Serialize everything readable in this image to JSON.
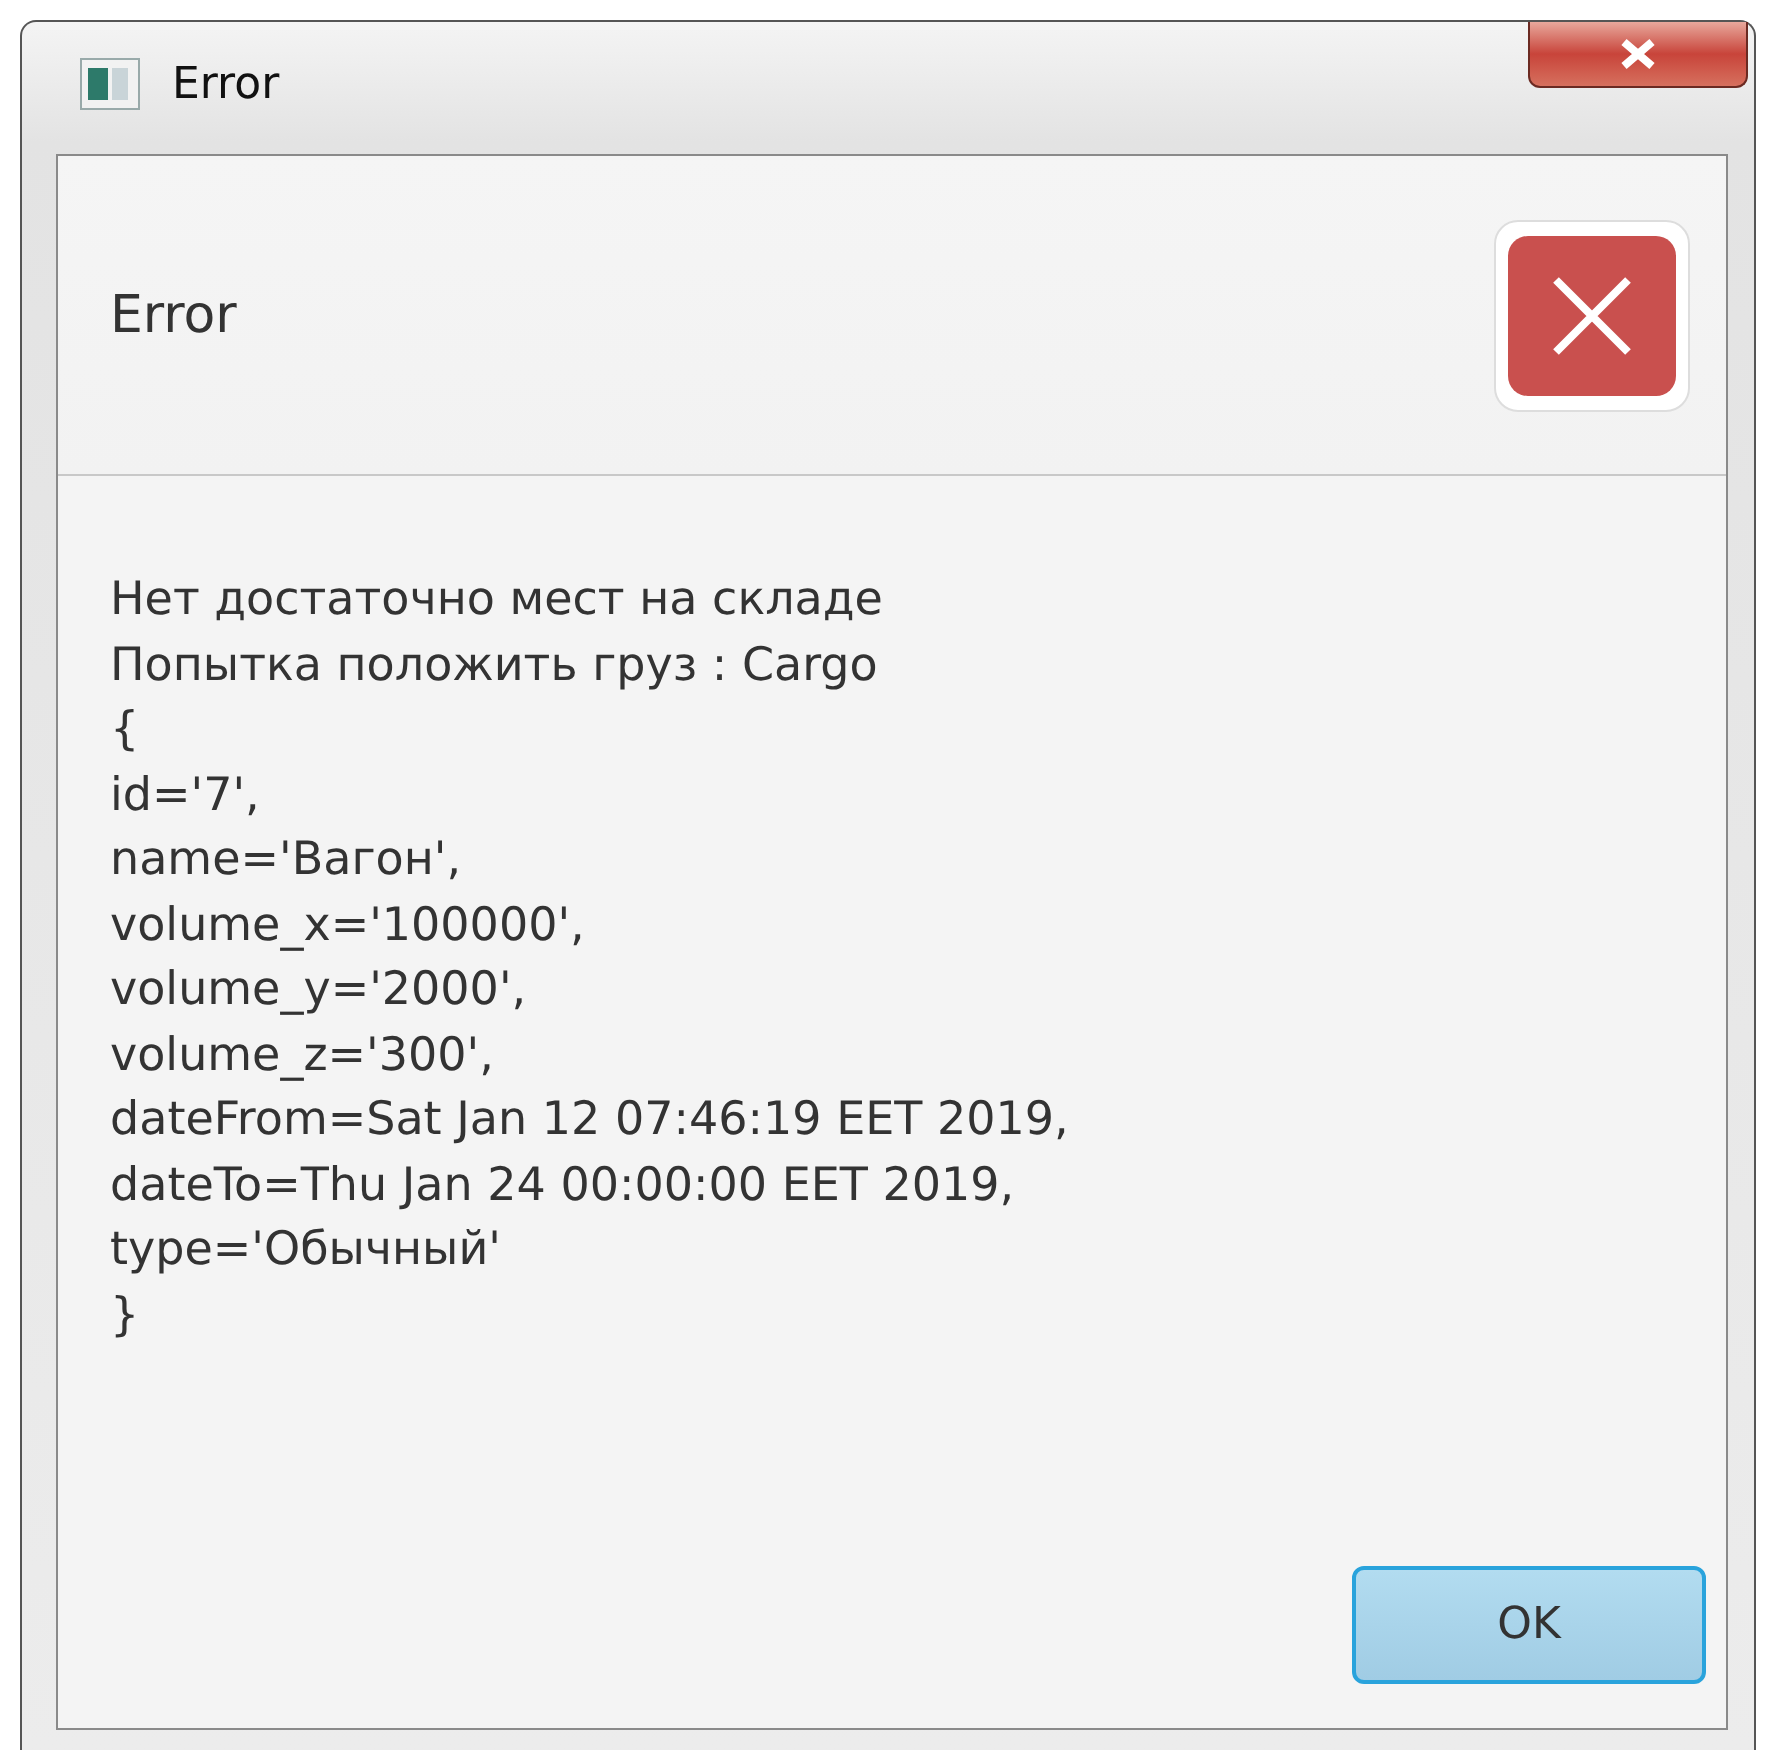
{
  "window": {
    "title": "Error"
  },
  "header": {
    "title": "Error"
  },
  "message_lines": [
    "Нет достаточно мест на складе",
    "Попытка положить груз : Cargo",
    "{",
    "id='7',",
    "name='Вагон',",
    "volume_x='100000',",
    "volume_y='2000',",
    "volume_z='300',",
    "dateFrom=Sat Jan 12 07:46:19 EET 2019,",
    "dateTo=Thu Jan 24 00:00:00 EET 2019,",
    "type='Обычный'",
    "}"
  ],
  "buttons": [
    {
      "label": "OK",
      "selected": true
    }
  ]
}
